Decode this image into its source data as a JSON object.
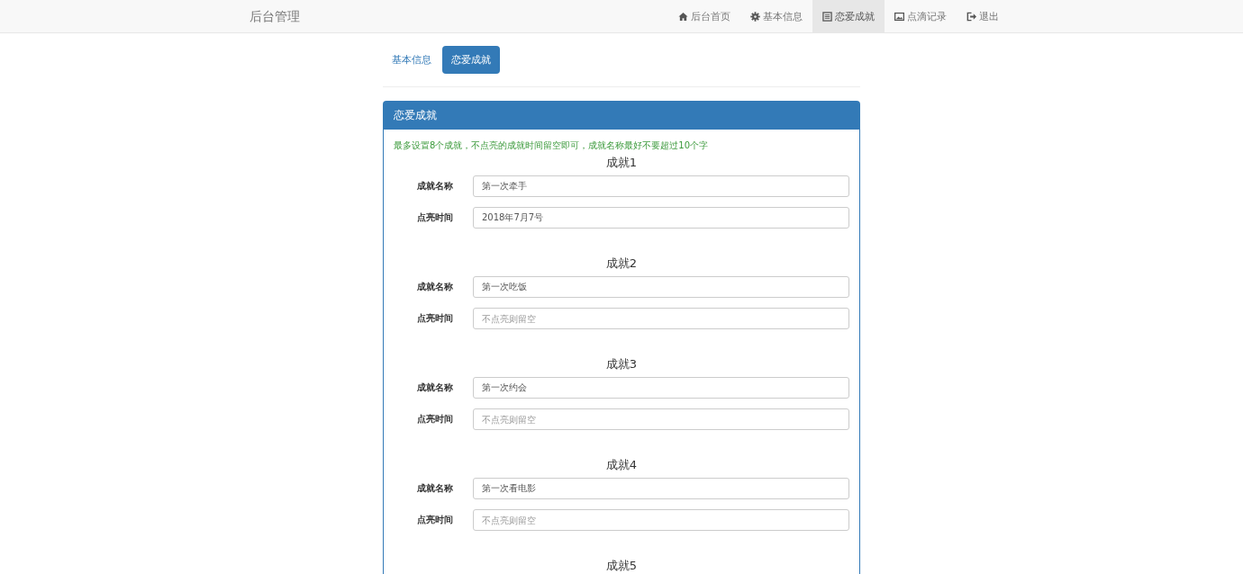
{
  "navbar": {
    "brand": "后台管理",
    "items": [
      {
        "kind": "home",
        "label": "后台首页",
        "selected": false
      },
      {
        "kind": "gear",
        "label": "基本信息",
        "selected": false
      },
      {
        "kind": "list",
        "label": "恋爱成就",
        "selected": true
      },
      {
        "kind": "picture",
        "label": "点滴记录",
        "selected": false
      },
      {
        "kind": "logout",
        "label": "退出",
        "selected": false
      }
    ]
  },
  "tabs": [
    {
      "label": "基本信息",
      "selected": false
    },
    {
      "label": "恋爱成就",
      "selected": true
    }
  ],
  "panel": {
    "title": "恋爱成就",
    "hint": "最多设置8个成就，不点亮的成就时间留空即可，成就名称最好不要超过10个字",
    "achievements": [
      {
        "title": "成就1",
        "fields": [
          {
            "label": "成就名称",
            "value": "第一次牵手"
          },
          {
            "label": "点亮时间",
            "value": "2018年7月7号"
          }
        ]
      },
      {
        "title": "成就2",
        "fields": [
          {
            "label": "成就名称",
            "value": "第一次吃饭"
          },
          {
            "label": "点亮时间",
            "placeholder": "不点亮则留空"
          }
        ]
      },
      {
        "title": "成就3",
        "fields": [
          {
            "label": "成就名称",
            "value": "第一次约会"
          },
          {
            "label": "点亮时间",
            "placeholder": "不点亮则留空"
          }
        ]
      },
      {
        "title": "成就4",
        "fields": [
          {
            "label": "成就名称",
            "value": "第一次看电影"
          },
          {
            "label": "点亮时间",
            "placeholder": "不点亮则留空"
          }
        ]
      },
      {
        "title": "成就5"
      }
    ]
  }
}
